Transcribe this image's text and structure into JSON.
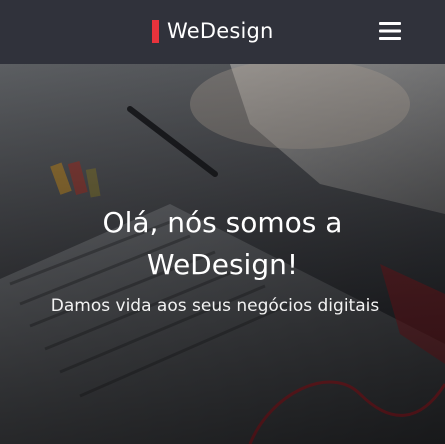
{
  "header": {
    "brand_name": "WeDesign",
    "brand_color": "#e8333c",
    "menu_icon": "hamburger-menu-icon"
  },
  "hero": {
    "title_line1": "Olá, nós somos a",
    "title_line2": "WeDesign!",
    "subtitle": "Damos vida aos seus negócios digitais",
    "background_image": "laptop-keyboard-desk-photo"
  }
}
